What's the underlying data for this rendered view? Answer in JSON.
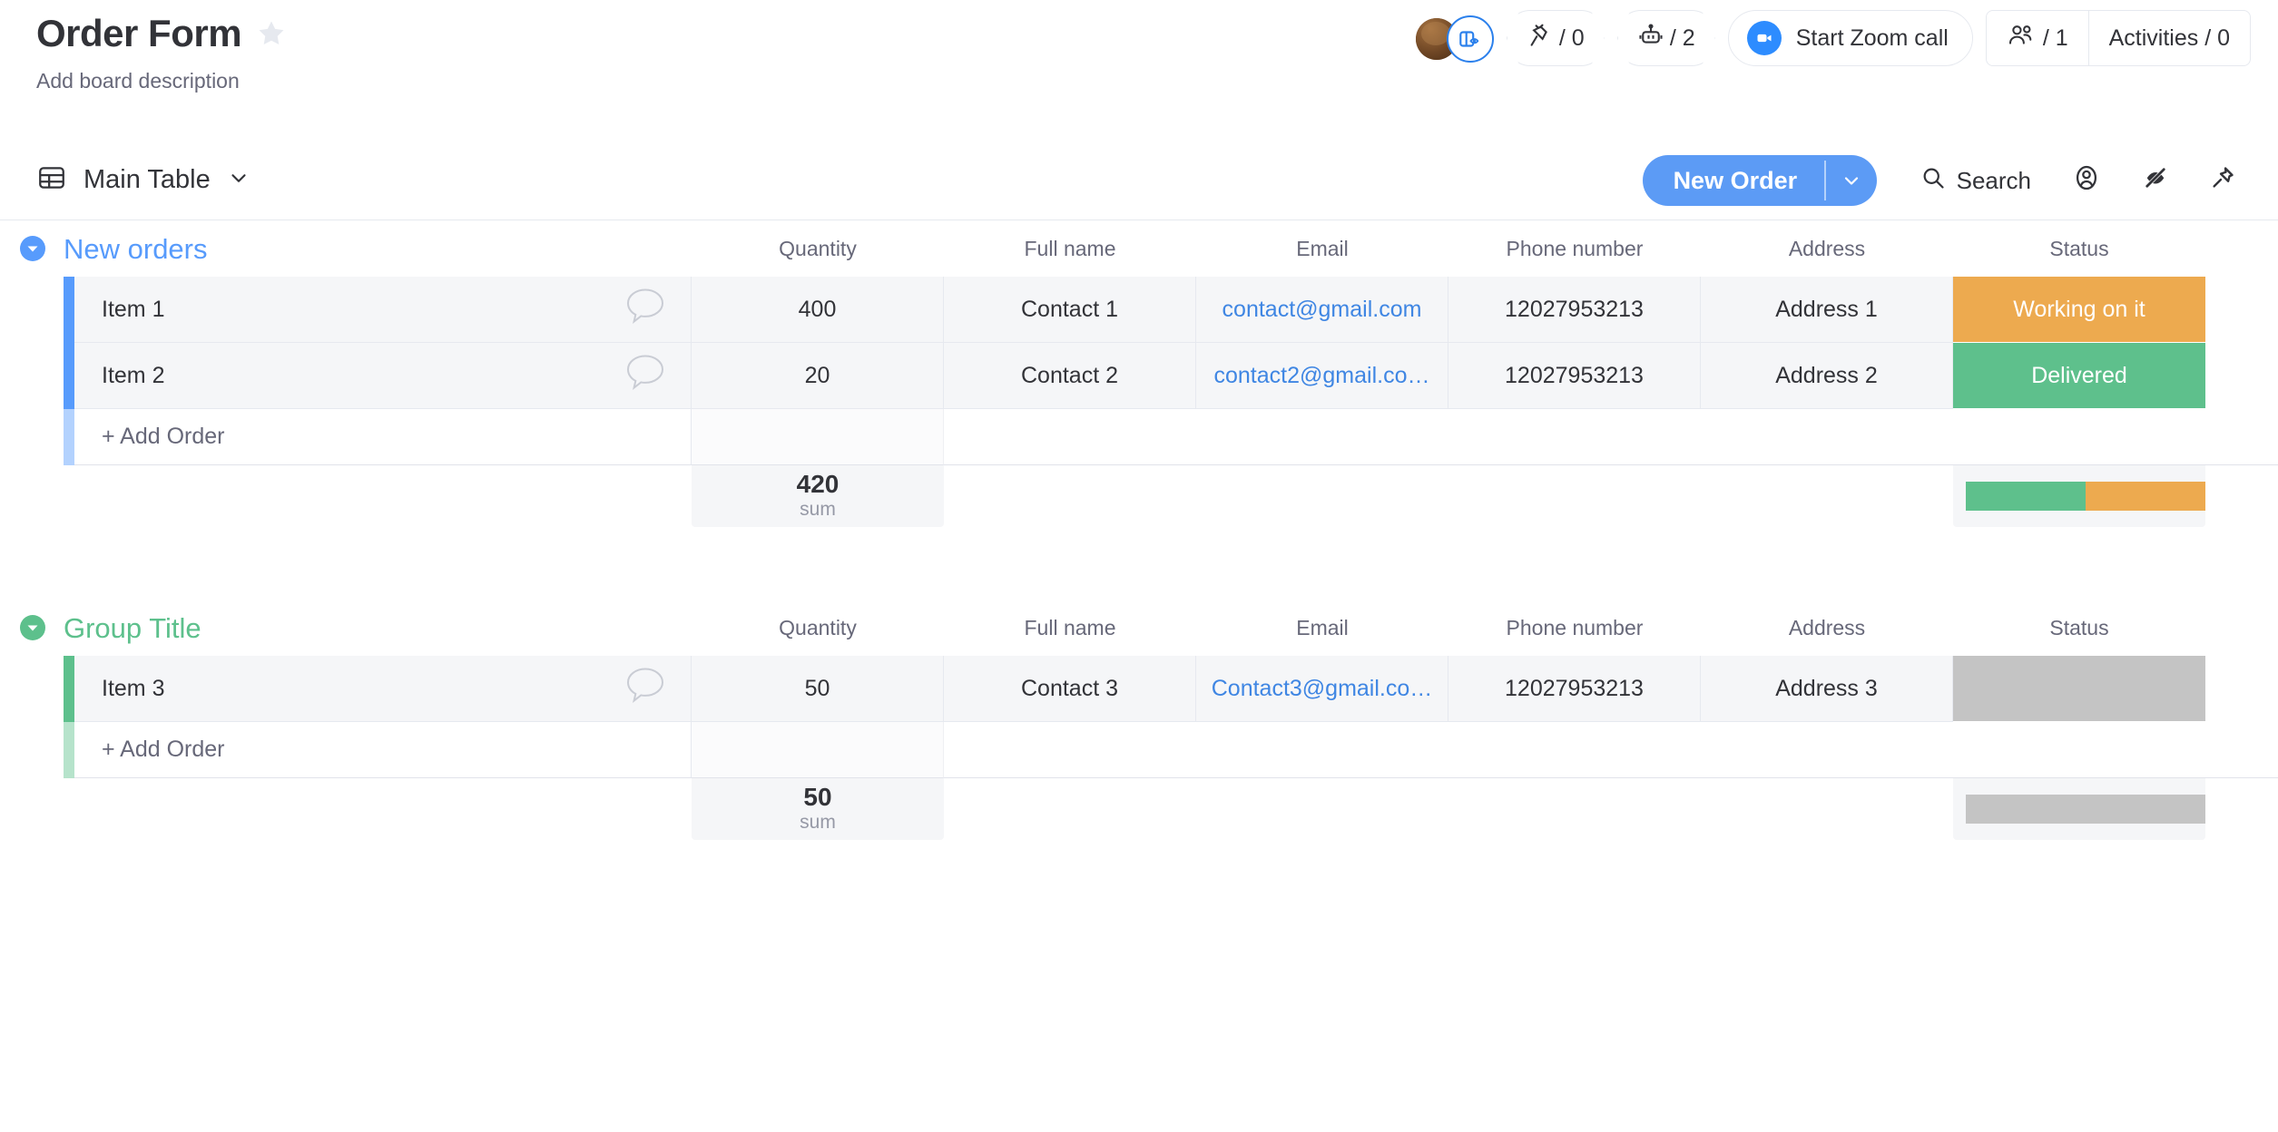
{
  "header": {
    "board_title": "Order Form",
    "favorite_icon": "star-icon",
    "board_description": "Add board description",
    "avatar_badge_icon": "board-view-eye-icon",
    "integrations": {
      "icon": "plug-integration-icon",
      "label": "/ 0"
    },
    "automations": {
      "icon": "robot-automation-icon",
      "label": "/ 2"
    },
    "zoom": {
      "icon": "zoom-video-icon",
      "label": "Start Zoom call"
    },
    "invite": {
      "icon": "people-icon",
      "label": "/ 1"
    },
    "activities": {
      "label": "Activities / 0"
    }
  },
  "toolbar": {
    "view_icon": "table-view-icon",
    "view_name": "Main Table",
    "view_chevron_icon": "chevron-down-icon",
    "new_item_label": "New Order",
    "new_item_arrow_icon": "chevron-down-icon",
    "search_icon": "search-icon",
    "search_label": "Search",
    "person_icon": "person-filter-icon",
    "hide_icon": "eye-hidden-icon",
    "pin_icon": "pin-icon"
  },
  "columns": [
    "Quantity",
    "Full name",
    "Email",
    "Phone number",
    "Address",
    "Status"
  ],
  "add_row_label": "+ Add Order",
  "sum_label": "sum",
  "colors": {
    "group1": "#579bfc",
    "group2": "#5dc08c",
    "status_working": "#edaa4f",
    "status_delivered": "#5ec08c",
    "status_empty": "#c4c4c4",
    "link": "#3f86e3",
    "primary": "#5c9bf5"
  },
  "groups": [
    {
      "title": "New orders",
      "color": "#579bfc",
      "collapse_icon": "chevron-down-circle-icon",
      "rows": [
        {
          "name": "Item 1",
          "chat_icon": "comment-bubble-icon",
          "quantity": "400",
          "full_name": "Contact 1",
          "email": "contact@gmail.com",
          "phone": "12027953213",
          "address": "Address 1",
          "status": "Working on it",
          "status_color": "#edaa4f"
        },
        {
          "name": "Item 2",
          "chat_icon": "comment-bubble-icon",
          "quantity": "20",
          "full_name": "Contact 2",
          "email": "contact2@gmail.co…",
          "phone": "12027953213",
          "address": "Address 2",
          "status": "Delivered",
          "status_color": "#5ec08c"
        }
      ],
      "summary": {
        "quantity_sum": "420",
        "status_segments": [
          {
            "color": "#5ec08c",
            "pct": 50
          },
          {
            "color": "#edaa4f",
            "pct": 50
          }
        ]
      }
    },
    {
      "title": "Group Title",
      "color": "#5dc08c",
      "collapse_icon": "chevron-down-circle-icon",
      "rows": [
        {
          "name": "Item 3",
          "chat_icon": "comment-bubble-icon",
          "quantity": "50",
          "full_name": "Contact 3",
          "email": "Contact3@gmail.co…",
          "phone": "12027953213",
          "address": "Address 3",
          "status": "",
          "status_color": "#c4c4c4"
        }
      ],
      "summary": {
        "quantity_sum": "50",
        "status_segments": [
          {
            "color": "#c4c4c4",
            "pct": 100
          }
        ]
      }
    }
  ]
}
